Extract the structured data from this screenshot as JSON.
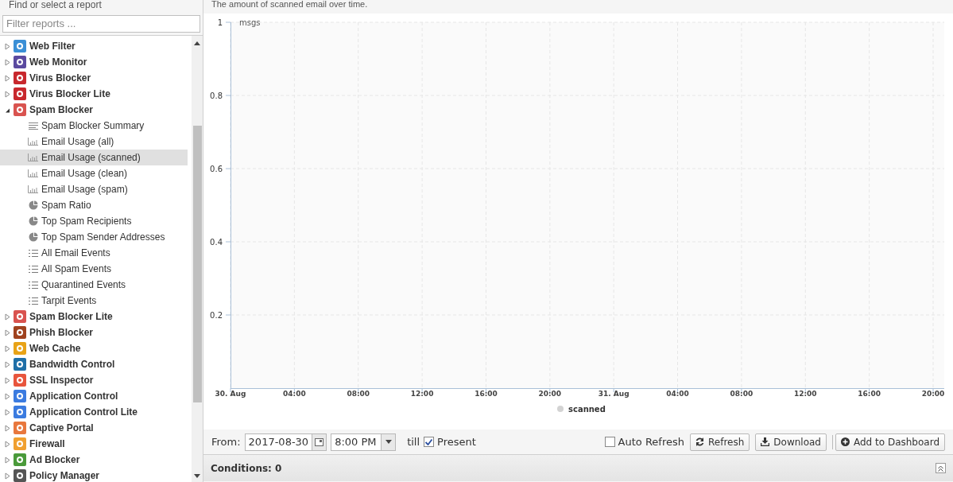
{
  "sidebar": {
    "title": "Find or select a report",
    "filter": {
      "placeholder": "Filter reports ..."
    },
    "items": [
      {
        "label": "Web Filter",
        "expanded": false,
        "color": "#3a8fd6"
      },
      {
        "label": "Web Monitor",
        "expanded": false,
        "color": "#5b4aa0"
      },
      {
        "label": "Virus Blocker",
        "expanded": false,
        "color": "#c8282d"
      },
      {
        "label": "Virus Blocker Lite",
        "expanded": false,
        "color": "#c8282d"
      },
      {
        "label": "Spam Blocker",
        "expanded": true,
        "color": "#d9534f",
        "children": [
          {
            "label": "Spam Blocker Summary",
            "kind": "summary",
            "selected": false
          },
          {
            "label": "Email Usage (all)",
            "kind": "bar",
            "selected": false
          },
          {
            "label": "Email Usage (scanned)",
            "kind": "bar",
            "selected": true
          },
          {
            "label": "Email Usage (clean)",
            "kind": "bar",
            "selected": false
          },
          {
            "label": "Email Usage (spam)",
            "kind": "bar",
            "selected": false
          },
          {
            "label": "Spam Ratio",
            "kind": "pie",
            "selected": false
          },
          {
            "label": "Top Spam Recipients",
            "kind": "pie",
            "selected": false
          },
          {
            "label": "Top Spam Sender Addresses",
            "kind": "pie",
            "selected": false
          },
          {
            "label": "All Email Events",
            "kind": "list",
            "selected": false
          },
          {
            "label": "All Spam Events",
            "kind": "list",
            "selected": false
          },
          {
            "label": "Quarantined Events",
            "kind": "list",
            "selected": false
          },
          {
            "label": "Tarpit Events",
            "kind": "list",
            "selected": false
          }
        ]
      },
      {
        "label": "Spam Blocker Lite",
        "expanded": false,
        "color": "#d9534f"
      },
      {
        "label": "Phish Blocker",
        "expanded": false,
        "color": "#a0421e"
      },
      {
        "label": "Web Cache",
        "expanded": false,
        "color": "#e8a317"
      },
      {
        "label": "Bandwidth Control",
        "expanded": false,
        "color": "#1f6fa8"
      },
      {
        "label": "SSL Inspector",
        "expanded": false,
        "color": "#e8553d"
      },
      {
        "label": "Application Control",
        "expanded": false,
        "color": "#3b7be0"
      },
      {
        "label": "Application Control Lite",
        "expanded": false,
        "color": "#3b7be0"
      },
      {
        "label": "Captive Portal",
        "expanded": false,
        "color": "#e8773d"
      },
      {
        "label": "Firewall",
        "expanded": false,
        "color": "#f0a030"
      },
      {
        "label": "Ad Blocker",
        "expanded": false,
        "color": "#4a9a3a"
      },
      {
        "label": "Policy Manager",
        "expanded": false,
        "color": "#555555"
      }
    ]
  },
  "report": {
    "description": "The amount of scanned email over time.",
    "chart_data": {
      "type": "line",
      "ylabel": "msgs",
      "ylim": [
        0,
        1
      ],
      "yticks": [
        0.2,
        0.4,
        0.6,
        0.8,
        1
      ],
      "categories": [
        "30. Aug",
        "04:00",
        "08:00",
        "12:00",
        "16:00",
        "20:00",
        "31. Aug",
        "04:00",
        "08:00",
        "12:00",
        "16:00",
        "20:00"
      ],
      "grid": true,
      "series": [
        {
          "name": "scanned",
          "color": "#d3d3d3",
          "values": [
            null,
            null,
            null,
            null,
            null,
            null,
            null,
            null,
            null,
            null,
            null,
            null
          ]
        }
      ]
    }
  },
  "toolbar": {
    "from_label": "From:",
    "date": "2017-08-30",
    "time": "8:00 PM",
    "till_label": "till",
    "present": {
      "label": "Present",
      "checked": true
    },
    "auto_refresh": {
      "label": "Auto Refresh",
      "checked": false
    },
    "buttons": [
      {
        "label": "Refresh",
        "kind": "refresh"
      },
      {
        "label": "Download",
        "kind": "download"
      },
      {
        "label": "Add to Dashboard",
        "kind": "add"
      }
    ]
  },
  "conditions": {
    "title": "Conditions: 0"
  }
}
